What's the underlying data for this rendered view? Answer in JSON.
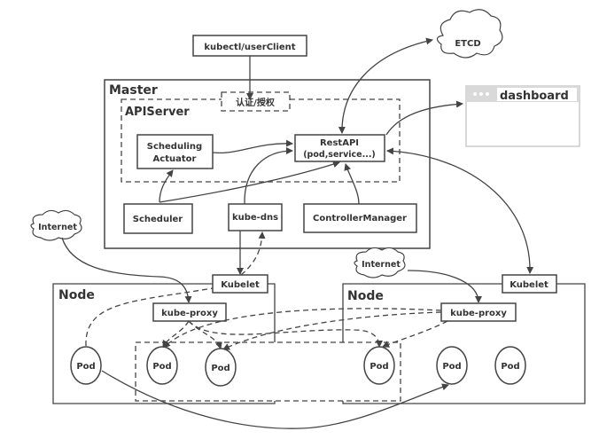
{
  "client": "kubectl/userClient",
  "etcd": "ETCD",
  "dashboard": "dashboard",
  "master": {
    "title": "Master",
    "auth": "认证/授权",
    "apiserver": "APIServer",
    "scheduling_actuator": [
      "Scheduling",
      "Actuator"
    ],
    "restapi": [
      "RestAPI",
      "(pod,service...)"
    ],
    "scheduler": "Scheduler",
    "kube_dns": "kube-dns",
    "controller_manager": "ControllerManager"
  },
  "internet": "Internet",
  "nodes": [
    {
      "title": "Node",
      "kubelet": "Kubelet",
      "kube_proxy": "kube-proxy"
    },
    {
      "title": "Node",
      "kubelet": "Kubelet",
      "kube_proxy": "kube-proxy"
    }
  ],
  "pod": "Pod"
}
